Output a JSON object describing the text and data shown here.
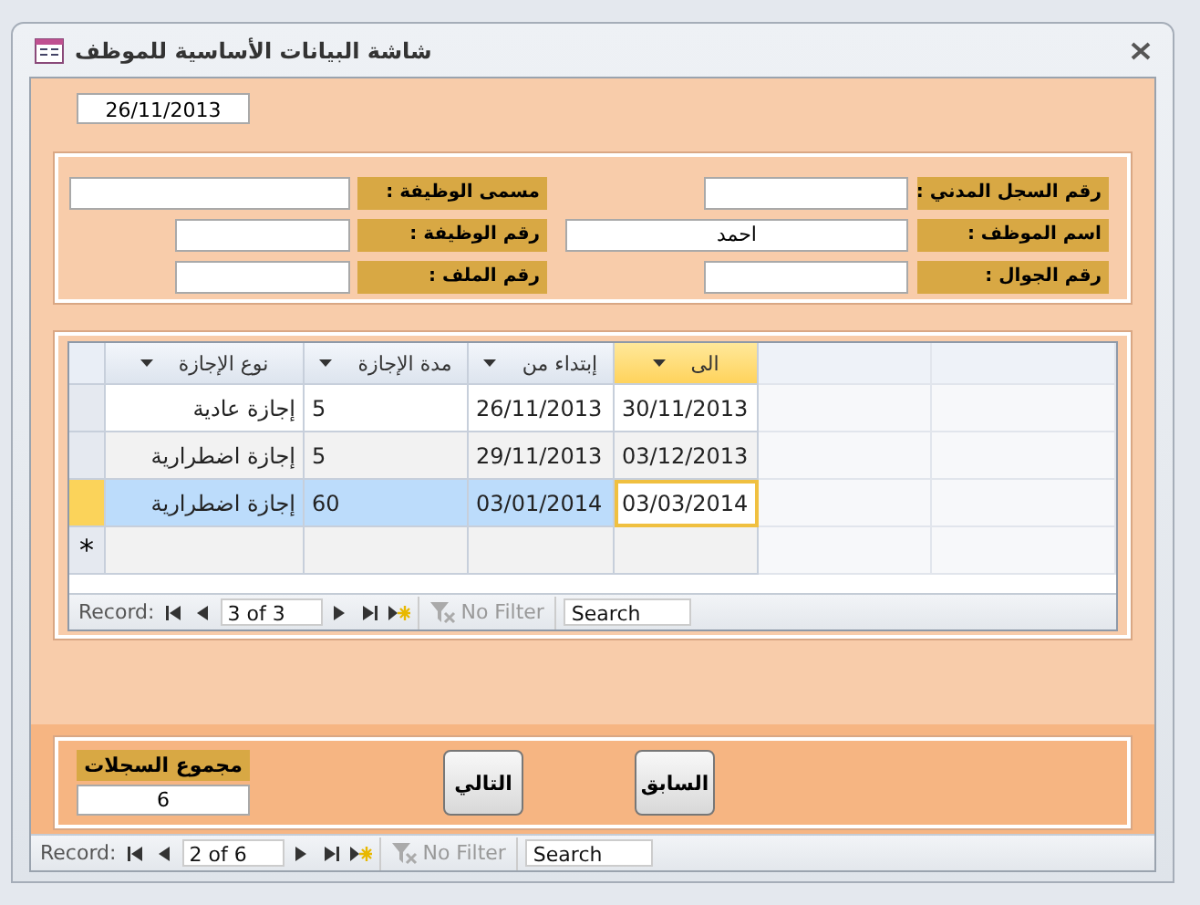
{
  "window": {
    "title": "شاشة البيانات الأساسية للموظف"
  },
  "date": "26/11/2013",
  "info_rows": [
    [
      {
        "label": "رقم السجل المدني :"
      },
      {
        "label": "مسمى الوظيفة :"
      }
    ],
    [
      {
        "label": "اسم الموظف :",
        "value": "احمد"
      },
      {
        "label": "رقم الوظيفة :"
      }
    ],
    [
      {
        "label": "رقم الجوال :"
      },
      {
        "label": "رقم الملف :"
      }
    ]
  ],
  "leave_table": {
    "columns": [
      {
        "label": "الى",
        "selected": true
      },
      {
        "label": "إبتداء من",
        "selected": false
      },
      {
        "label": "مدة الإجازة",
        "selected": false
      },
      {
        "label": "نوع الإجازة",
        "selected": false
      }
    ],
    "rows": [
      {
        "cells": [
          "30/11/2013",
          "26/11/2013",
          "5",
          "إجازة عادية"
        ],
        "selected": false
      },
      {
        "cells": [
          "03/12/2013",
          "29/11/2013",
          "5",
          "إجازة اضطرارية"
        ],
        "selected": false
      },
      {
        "cells": [
          "03/03/2014",
          "03/01/2014",
          "60",
          "إجازة اضطرارية"
        ],
        "selected": true
      }
    ],
    "new_row_marker": "*",
    "navigation": {
      "label": "Record:",
      "position": "3 of 3",
      "filter": "No Filter",
      "search": "Search"
    }
  },
  "total": {
    "label": "مجموع السجلات",
    "value": "6"
  },
  "buttons": [
    "السابق",
    "التالي"
  ],
  "navigation": {
    "label": "Record:",
    "position": "2 of 6",
    "filter": "No Filter",
    "search": "Search"
  }
}
